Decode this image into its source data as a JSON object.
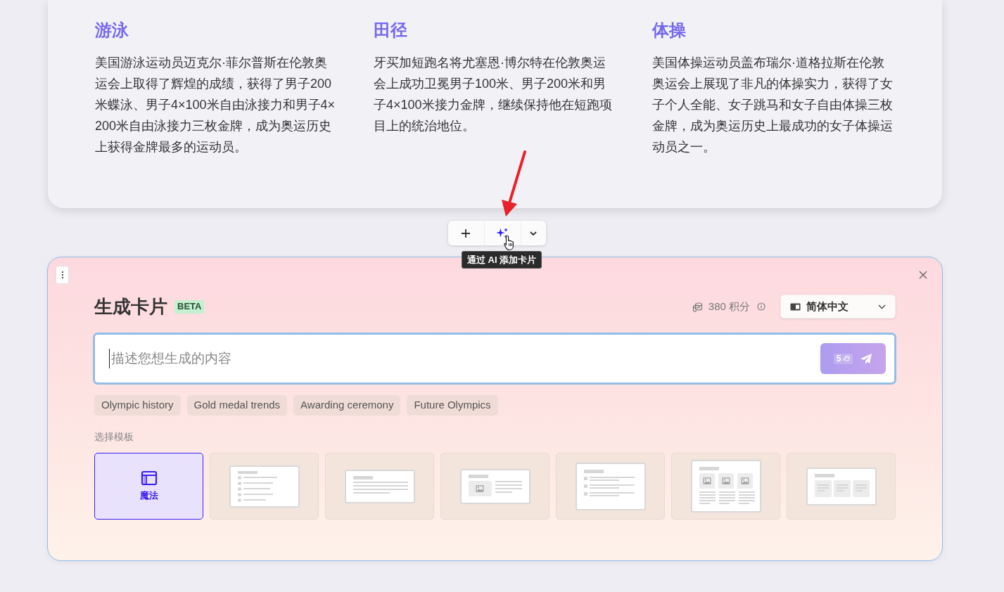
{
  "sports": [
    {
      "title": "游泳",
      "text": "美国游泳运动员迈克尔·菲尔普斯在伦敦奥运会上取得了辉煌的成绩，获得了男子200米蝶泳、男子4×100米自由泳接力和男子4×200米自由泳接力三枚金牌，成为奥运历史上获得金牌最多的运动员。"
    },
    {
      "title": "田径",
      "text": "牙买加短跑名将尤塞恩·博尔特在伦敦奥运会上成功卫冕男子100米、男子200米和男子4×100米接力金牌，继续保持他在短跑项目上的统治地位。"
    },
    {
      "title": "体操",
      "text": "美国体操运动员盖布瑞尔·道格拉斯在伦敦奥运会上展现了非凡的体操实力，获得了女子个人全能、女子跳马和女子自由体操三枚金牌，成为奥运历史上最成功的女子体操运动员之一。"
    }
  ],
  "toolbar": {
    "tooltip": "通过 AI 添加卡片"
  },
  "generator": {
    "title": "生成卡片",
    "badge": "BETA",
    "credits": "380 积分",
    "language": "简体中文",
    "placeholder": "描述您想生成的内容",
    "cost": "5",
    "suggestions": [
      "Olympic history",
      "Gold medal trends",
      "Awarding ceremony",
      "Future Olympics"
    ],
    "template_label": "选择模板",
    "templates": [
      {
        "kind": "magic",
        "label": "魔法",
        "selected": true
      },
      {
        "kind": "bullets",
        "selected": false
      },
      {
        "kind": "text",
        "selected": false
      },
      {
        "kind": "image-text",
        "selected": false
      },
      {
        "kind": "timeline",
        "selected": false
      },
      {
        "kind": "three-images",
        "selected": false
      },
      {
        "kind": "three-columns",
        "selected": false
      }
    ]
  }
}
